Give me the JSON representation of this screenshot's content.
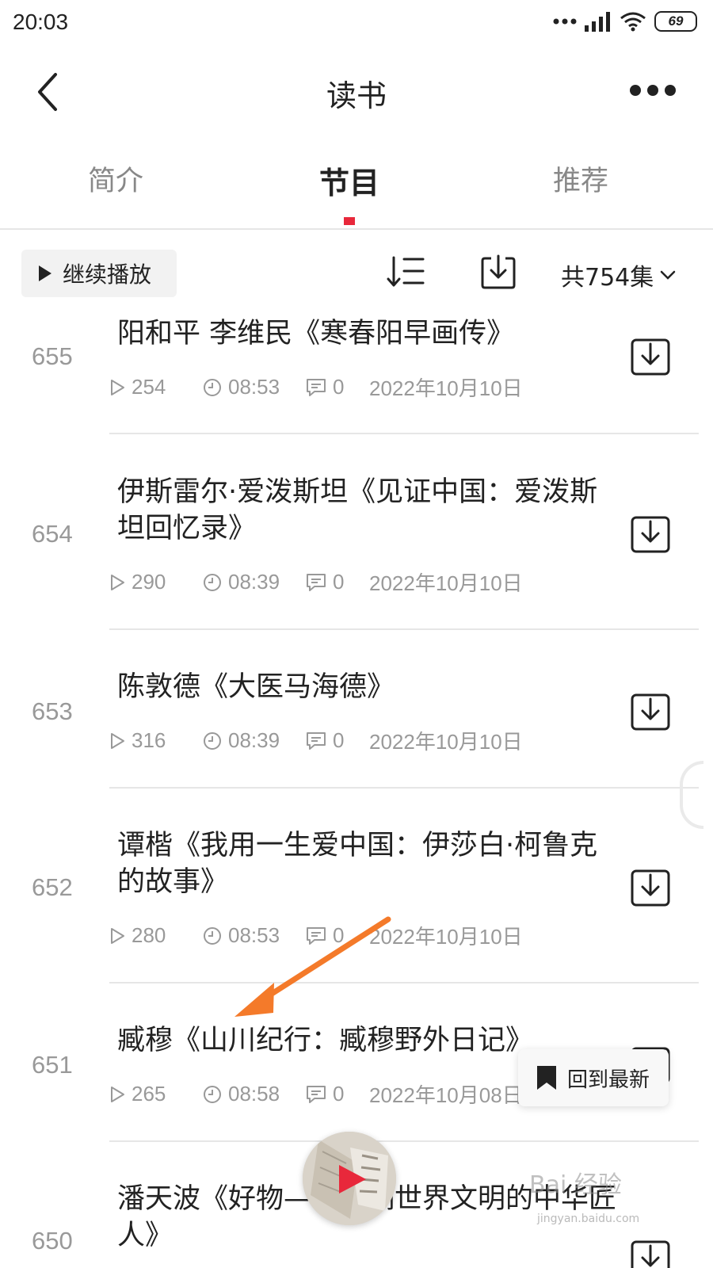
{
  "status_bar": {
    "time": "20:03",
    "battery": "69"
  },
  "nav": {
    "title": "读书"
  },
  "tabs": [
    {
      "label": "简介"
    },
    {
      "label": "节目"
    },
    {
      "label": "推荐"
    }
  ],
  "toolbar": {
    "continue_label": "继续播放",
    "episode_count": "共754集"
  },
  "episodes": [
    {
      "number": "655",
      "title": "阳和平 李维民《寒春阳早画传》",
      "plays": "254",
      "duration": "08:53",
      "comments": "0",
      "date": "2022年10月10日"
    },
    {
      "number": "654",
      "title": "伊斯雷尔·爱泼斯坦《见证中国：爱泼斯坦回忆录》",
      "plays": "290",
      "duration": "08:39",
      "comments": "0",
      "date": "2022年10月10日"
    },
    {
      "number": "653",
      "title": "陈敦德《大医马海德》",
      "plays": "316",
      "duration": "08:39",
      "comments": "0",
      "date": "2022年10月10日"
    },
    {
      "number": "652",
      "title": "谭楷《我用一生爱中国：伊莎白·柯鲁克的故事》",
      "plays": "280",
      "duration": "08:53",
      "comments": "0",
      "date": "2022年10月10日"
    },
    {
      "number": "651",
      "title": "臧穆《山川纪行：臧穆野外日记》",
      "plays": "265",
      "duration": "08:58",
      "comments": "0",
      "date": "2022年10月08日"
    },
    {
      "number": "650",
      "title": "潘天波《好物——影响世界文明的中华匠人》",
      "plays": "",
      "duration": "",
      "comments": "",
      "date": ""
    }
  ],
  "floating": {
    "back_to_latest": "回到最新"
  },
  "watermark": {
    "text": "Bai 经验",
    "sub": "jingyan.baidu.com"
  },
  "colors": {
    "accent": "#e8283b",
    "arrow": "#f47a2a",
    "muted": "#999999"
  }
}
